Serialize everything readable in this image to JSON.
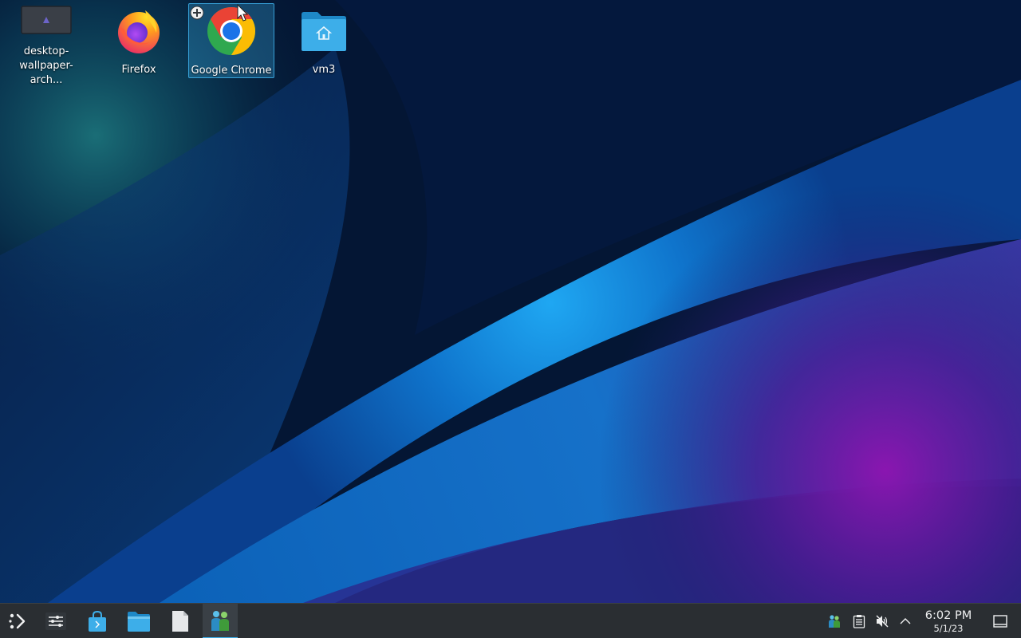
{
  "desktop": {
    "icons": [
      {
        "label": "desktop-\nwallpaper-arch...",
        "icon": "image-file-icon",
        "selected": false
      },
      {
        "label": "Firefox",
        "icon": "firefox-icon",
        "selected": false
      },
      {
        "label": "Google Chrome",
        "icon": "chrome-icon",
        "selected": true
      },
      {
        "label": "vm3",
        "icon": "home-folder-icon",
        "selected": false
      }
    ],
    "wallpaper": "KDE Plasma blue/purple wave"
  },
  "taskbar": {
    "launcher_icon": "application-launcher-icon",
    "apps": [
      {
        "name": "system-settings-icon"
      },
      {
        "name": "discover-store-icon"
      },
      {
        "name": "file-manager-icon"
      },
      {
        "name": "text-file-icon"
      },
      {
        "name": "user-app-icon",
        "active": true
      }
    ],
    "tray": [
      {
        "name": "network-user-icon"
      },
      {
        "name": "clipboard-icon"
      },
      {
        "name": "volume-muted-icon"
      },
      {
        "name": "chevron-up-icon"
      }
    ],
    "clock": {
      "time": "6:02 PM",
      "date": "5/1/23"
    },
    "show_desktop_icon": "show-desktop-icon"
  },
  "colors": {
    "accent": "#3daee9",
    "panel": "#2a2e32",
    "text": "#eff0f1"
  }
}
